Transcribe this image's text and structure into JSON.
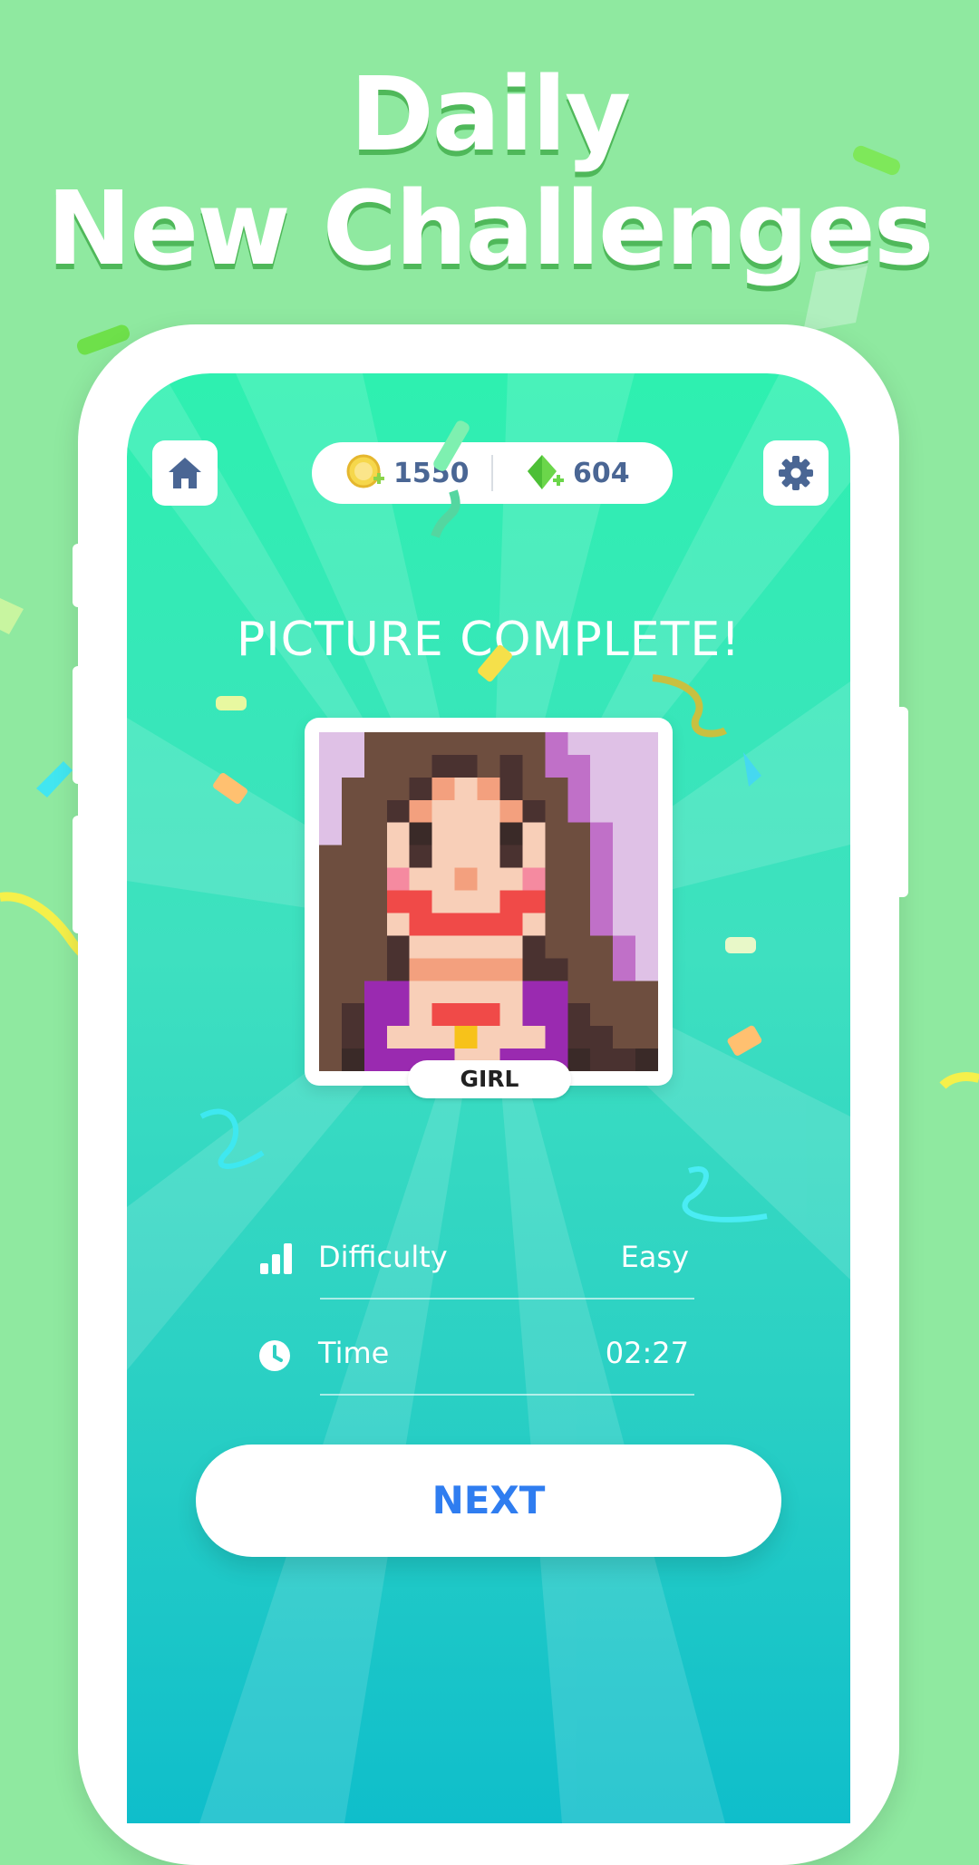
{
  "headline": {
    "line1": "Daily",
    "line2": "New Challenges"
  },
  "topbar": {
    "home_icon": "home-icon",
    "settings_icon": "gear-icon",
    "coins": "1550",
    "gems": "604"
  },
  "result": {
    "title": "PICTURE COMPLETE!",
    "picture_name": "GIRL"
  },
  "stats": [
    {
      "icon": "signal-bars-icon",
      "label": "Difficulty",
      "value": "Easy"
    },
    {
      "icon": "clock-icon",
      "label": "Time",
      "value": "02:27"
    }
  ],
  "next_label": "NEXT",
  "colors": {
    "background": "#8fe9a0",
    "accent_blue": "#2f7df0",
    "currency_text": "#4a6694"
  }
}
